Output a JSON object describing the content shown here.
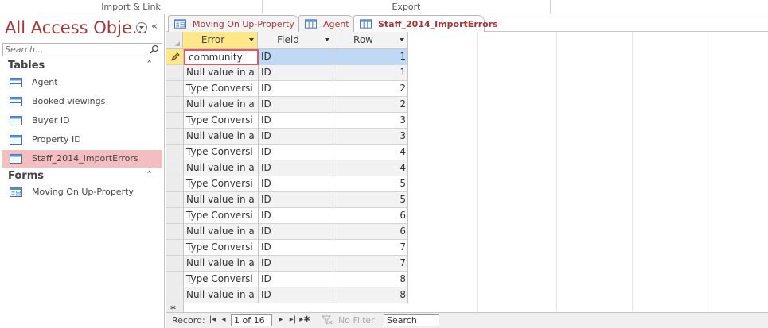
{
  "ribbon": {
    "groups": [
      {
        "label": "Import & Link"
      },
      {
        "label": "Export"
      }
    ]
  },
  "nav": {
    "title": "All Access Obje...",
    "search_placeholder": "Search...",
    "sections": [
      {
        "label": "Tables",
        "items": [
          {
            "label": "Agent",
            "icon": "table-icon"
          },
          {
            "label": "Booked viewings",
            "icon": "table-icon"
          },
          {
            "label": "Buyer ID",
            "icon": "table-icon"
          },
          {
            "label": "Property ID",
            "icon": "table-icon"
          },
          {
            "label": "Staff_2014_ImportErrors",
            "icon": "table-icon",
            "selected": true
          }
        ]
      },
      {
        "label": "Forms",
        "items": [
          {
            "label": "Moving On Up-Property",
            "icon": "form-icon"
          }
        ]
      }
    ]
  },
  "tabs": [
    {
      "label": "Moving On Up-Property",
      "icon": "form-icon"
    },
    {
      "label": "Agent",
      "icon": "table-icon"
    },
    {
      "label": "Staff_2014_ImportErrors",
      "icon": "table-icon",
      "active": true
    }
  ],
  "sheet": {
    "columns": [
      "Error",
      "Field",
      "Row"
    ],
    "editing_value": "community",
    "rows": [
      {
        "error": "community",
        "field": "ID",
        "row": "1"
      },
      {
        "error": "Null value in a",
        "field": "ID",
        "row": "1"
      },
      {
        "error": "Type Conversi",
        "field": "ID",
        "row": "2"
      },
      {
        "error": "Null value in a",
        "field": "ID",
        "row": "2"
      },
      {
        "error": "Type Conversi",
        "field": "ID",
        "row": "3"
      },
      {
        "error": "Null value in a",
        "field": "ID",
        "row": "3"
      },
      {
        "error": "Type Conversi",
        "field": "ID",
        "row": "4"
      },
      {
        "error": "Null value in a",
        "field": "ID",
        "row": "4"
      },
      {
        "error": "Type Conversi",
        "field": "ID",
        "row": "5"
      },
      {
        "error": "Null value in a",
        "field": "ID",
        "row": "5"
      },
      {
        "error": "Type Conversi",
        "field": "ID",
        "row": "6"
      },
      {
        "error": "Null value in a",
        "field": "ID",
        "row": "6"
      },
      {
        "error": "Type Conversi",
        "field": "ID",
        "row": "7"
      },
      {
        "error": "Null value in a",
        "field": "ID",
        "row": "7"
      },
      {
        "error": "Type Conversi",
        "field": "ID",
        "row": "8"
      },
      {
        "error": "Null value in a",
        "field": "ID",
        "row": "8"
      }
    ],
    "new_row_marker": "*"
  },
  "recnav": {
    "label": "Record:",
    "position": "1 of 16",
    "filter_label": "No Filter",
    "search_value": "Search"
  },
  "colors": {
    "accent": "#a4373a",
    "selected_nav": "#f4bdbf",
    "active_header": "#ffe88a",
    "current_row": "#bfd9f5"
  }
}
